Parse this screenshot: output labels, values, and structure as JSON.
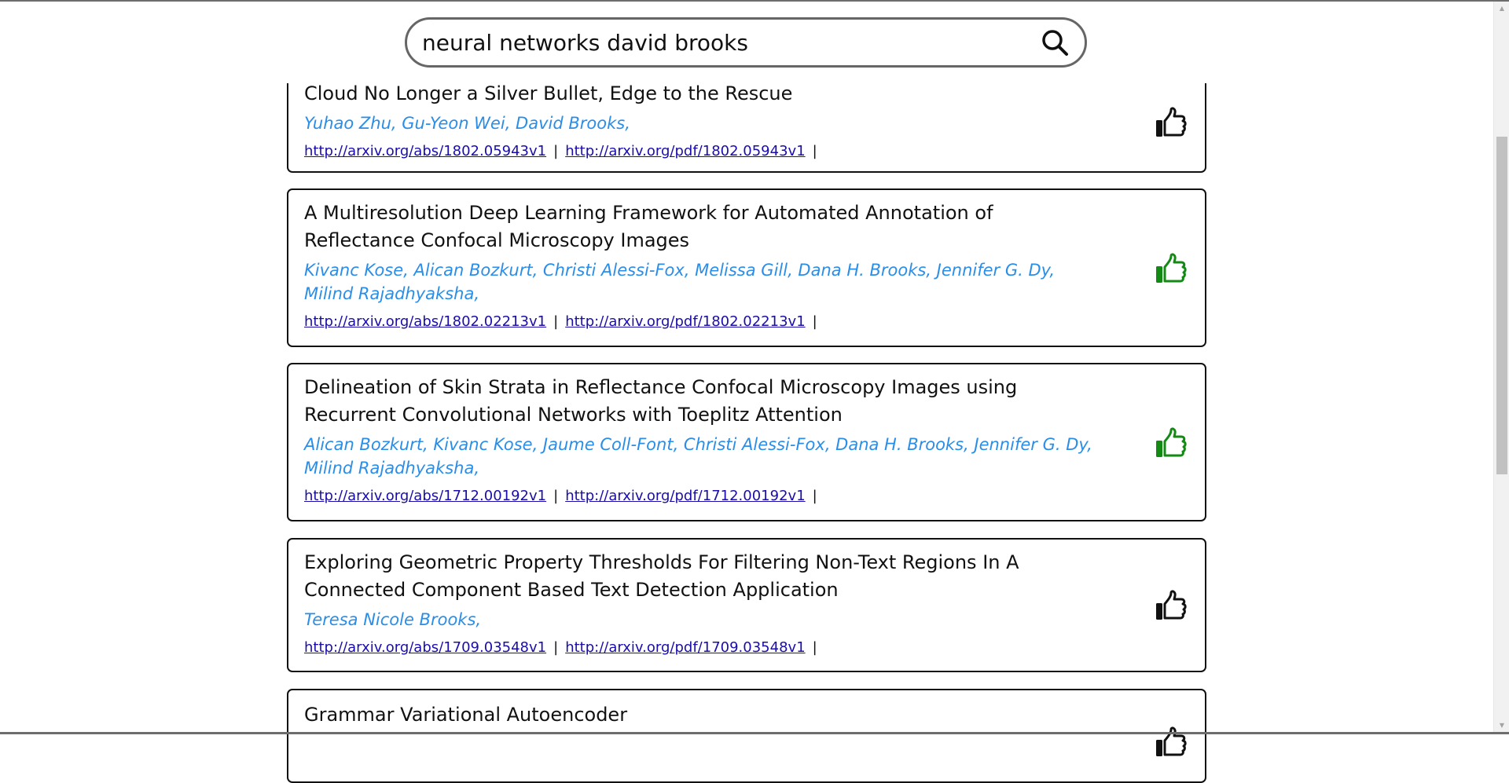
{
  "search": {
    "query": "neural networks david brooks"
  },
  "colors": {
    "liked": "#138a13",
    "not_liked": "#111111",
    "author": "#2a8ee8",
    "link": "#1a0dab"
  },
  "results": [
    {
      "title": "Cloud No Longer a Silver Bullet, Edge to the Rescue",
      "authors": "Yuhao Zhu, Gu-Yeon Wei, David Brooks,",
      "abs_link": "http://arxiv.org/abs/1802.05943v1",
      "pdf_link": "http://arxiv.org/pdf/1802.05943v1",
      "separator": "|",
      "liked": false,
      "icon": "thumbs-up-icon"
    },
    {
      "title": "A Multiresolution Deep Learning Framework for Automated Annotation of Reflectance Confocal Microscopy Images",
      "authors": "Kivanc Kose, Alican Bozkurt, Christi Alessi-Fox, Melissa Gill, Dana H. Brooks, Jennifer G. Dy, Milind Rajadhyaksha,",
      "abs_link": "http://arxiv.org/abs/1802.02213v1",
      "pdf_link": "http://arxiv.org/pdf/1802.02213v1",
      "separator": "|",
      "liked": true,
      "icon": "thumbs-up-icon"
    },
    {
      "title": "Delineation of Skin Strata in Reflectance Confocal Microscopy Images using Recurrent Convolutional Networks with Toeplitz Attention",
      "authors": "Alican Bozkurt, Kivanc Kose, Jaume Coll-Font, Christi Alessi-Fox, Dana H. Brooks, Jennifer G. Dy, Milind Rajadhyaksha,",
      "abs_link": "http://arxiv.org/abs/1712.00192v1",
      "pdf_link": "http://arxiv.org/pdf/1712.00192v1",
      "separator": "|",
      "liked": true,
      "icon": "thumbs-up-icon"
    },
    {
      "title": "Exploring Geometric Property Thresholds For Filtering Non-Text Regions In A Connected Component Based Text Detection Application",
      "authors": "Teresa Nicole Brooks,",
      "abs_link": "http://arxiv.org/abs/1709.03548v1",
      "pdf_link": "http://arxiv.org/pdf/1709.03548v1",
      "separator": "|",
      "liked": false,
      "icon": "thumbs-up-icon"
    },
    {
      "title": "Grammar Variational Autoencoder",
      "authors": "",
      "abs_link": "",
      "pdf_link": "",
      "separator": "",
      "liked": false,
      "icon": "thumbs-up-icon"
    }
  ]
}
